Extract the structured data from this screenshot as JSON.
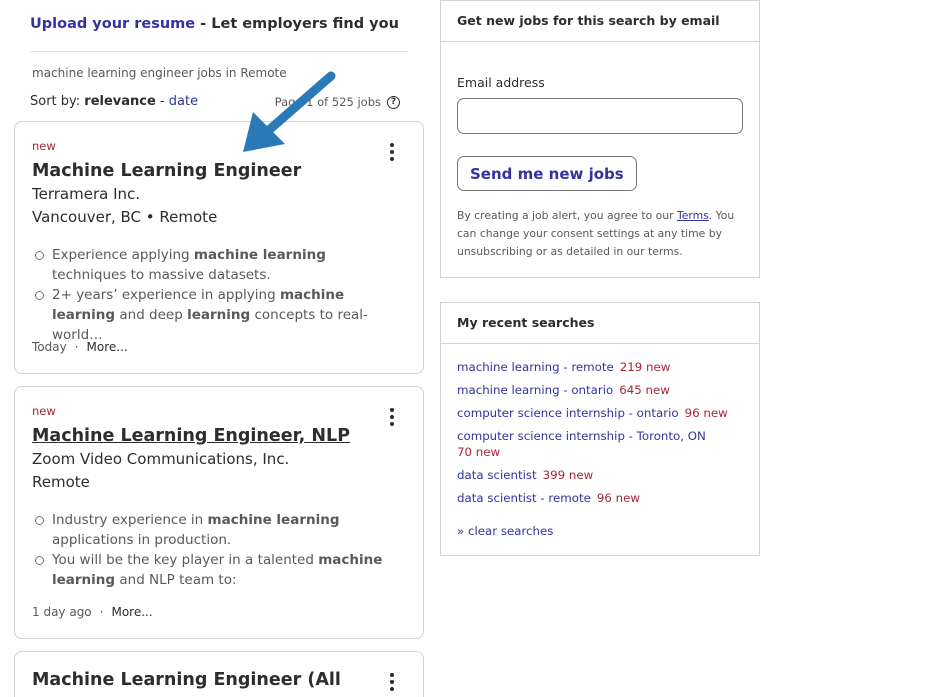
{
  "upload": {
    "link": "Upload your resume",
    "tail": " - Let employers find you"
  },
  "breadcrumb": "machine learning engineer jobs in Remote",
  "sort": {
    "prefix": "Sort by: ",
    "relevance": "relevance",
    "sep": " - ",
    "date": "date"
  },
  "page_count": "Page 1 of 525 jobs",
  "jobs": [
    {
      "tag": "new",
      "title": "Machine Learning Engineer",
      "company": "Terramera Inc.",
      "location": "Vancouver, BC  •  Remote",
      "bullets": [
        [
          "Experience applying ",
          "machine learning",
          " techniques to massive datasets.",
          "",
          ""
        ],
        [
          "2+ years’ experience in applying ",
          "machine learning",
          " and deep ",
          "learning",
          " concepts to real-world…"
        ]
      ],
      "posted": "Today",
      "more": "More..."
    },
    {
      "tag": "new",
      "title": "Machine Learning Engineer, NLP",
      "company": "Zoom Video Communications, Inc.",
      "location": "Remote",
      "bullets": [
        [
          "Industry experience in ",
          "machine learning",
          " applications in production.",
          "",
          ""
        ],
        [
          "You will be the key player in a talented ",
          "machine learning",
          " and NLP team to:",
          "",
          ""
        ]
      ],
      "posted": "1 day ago",
      "more": "More..."
    },
    {
      "title": "Machine Learning Engineer (All"
    }
  ],
  "alert": {
    "heading": "Get new jobs for this search by email",
    "email_label": "Email address",
    "email_value": "",
    "button": "Send me new jobs",
    "consent_pre": "By creating a job alert, you agree to our ",
    "terms": "Terms",
    "consent_post": ". You can change your consent settings at any time by unsubscribing or as detailed in our terms."
  },
  "recent": {
    "heading": "My recent searches",
    "items": [
      {
        "query": "machine learning - remote",
        "count": "219 new"
      },
      {
        "query": "machine learning - ontario",
        "count": "645 new"
      },
      {
        "query": "computer science internship - ontario",
        "count": "96 new"
      },
      {
        "query": "computer science internship - Toronto, ON",
        "count": "70 new"
      },
      {
        "query": "data scientist",
        "count": "399 new"
      },
      {
        "query": "data scientist - remote",
        "count": "96 new"
      }
    ],
    "clear": "» clear searches"
  },
  "colors": {
    "link": "#3333a0",
    "new_tag": "#a9253c",
    "arrow": "#2a7ab8"
  },
  "icons": {
    "kebab": "more-vertical-icon",
    "help": "help-circle-icon",
    "arrow": "annotation-arrow"
  }
}
